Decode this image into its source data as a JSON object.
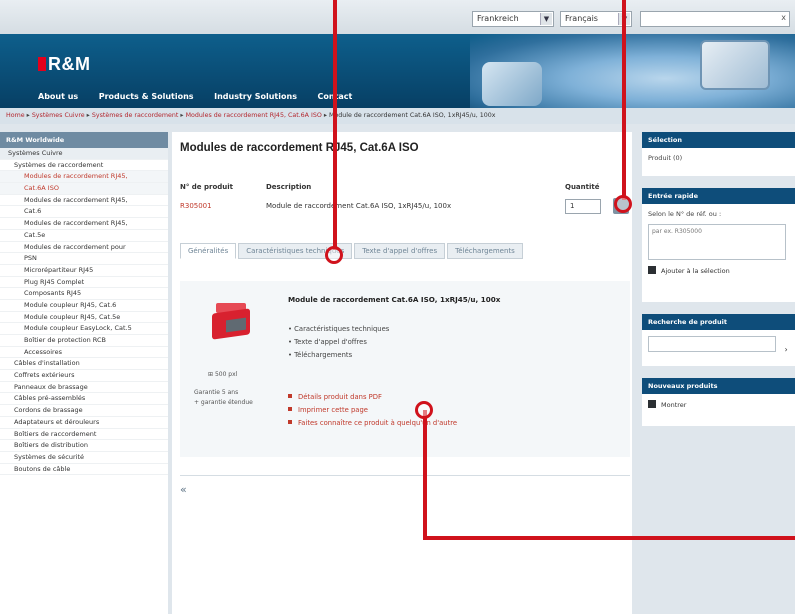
{
  "topbar": {
    "country": "Frankreich",
    "language": "Français",
    "search_close": "x"
  },
  "header": {
    "logo": "R&M",
    "nav": [
      "About us",
      "Products & Solutions",
      "Industry Solutions",
      "Contact"
    ]
  },
  "breadcrumb": {
    "items": [
      "Home",
      "Systèmes Cuivre",
      "Systèmes de raccordement",
      "Modules de raccordement RJ45, Cat.6A ISO"
    ],
    "current": "Module de raccordement Cat.6A ISO, 1xRJ45/u, 100x",
    "separator": "▸"
  },
  "sidebar": {
    "header": "R&M Worldwide",
    "items": [
      {
        "label": "Systèmes Cuivre",
        "level": 0,
        "top": true
      },
      {
        "label": "Systèmes de raccordement",
        "level": 1
      },
      {
        "label": "Modules de raccordement RJ45,",
        "level": 2,
        "active": true
      },
      {
        "label": "Cat.6A ISO",
        "level": 2,
        "active": true
      },
      {
        "label": "Modules de raccordement RJ45,",
        "level": 2
      },
      {
        "label": "Cat.6",
        "level": 2
      },
      {
        "label": "Modules de raccordement RJ45,",
        "level": 2
      },
      {
        "label": "Cat.5e",
        "level": 2
      },
      {
        "label": "Modules de raccordement pour",
        "level": 2
      },
      {
        "label": "PSN",
        "level": 2
      },
      {
        "label": "Microrépartiteur RJ45",
        "level": 2
      },
      {
        "label": "Plug RJ45 Complet",
        "level": 2
      },
      {
        "label": "Composants RJ45",
        "level": 2
      },
      {
        "label": "Module coupleur RJ45, Cat.6",
        "level": 2
      },
      {
        "label": "Module coupleur RJ45, Cat.5e",
        "level": 2
      },
      {
        "label": "Module coupleur EasyLock, Cat.5",
        "level": 2
      },
      {
        "label": "Boîtier de protection RCB",
        "level": 2
      },
      {
        "label": "Accessoires",
        "level": 2
      },
      {
        "label": "Câbles d'installation",
        "level": 1
      },
      {
        "label": "Coffrets extérieurs",
        "level": 1
      },
      {
        "label": "Panneaux de brassage",
        "level": 1
      },
      {
        "label": "Câbles pré-assemblés",
        "level": 1
      },
      {
        "label": "Cordons de brassage",
        "level": 1
      },
      {
        "label": "Adaptateurs et dérouleurs",
        "level": 1
      },
      {
        "label": "Boîtiers de raccordement",
        "level": 1
      },
      {
        "label": "Boîtiers de distribution",
        "level": 1
      },
      {
        "label": "Systèmes de sécurité",
        "level": 1
      },
      {
        "label": "Boutons de câble",
        "level": 1
      }
    ]
  },
  "main": {
    "title": "Modules de raccordement RJ45, Cat.6A ISO",
    "table": {
      "col_number": "N° de produit",
      "col_description": "Description",
      "col_quantity": "Quantité",
      "product_number": "R305001",
      "product_description": "Module de raccordement Cat.6A ISO, 1xRJ45/u, 100x",
      "quantity": "1"
    },
    "tabs": [
      "Généralités",
      "Caractéristiques techniques",
      "Texte d'appel d'offres",
      "Téléchargements"
    ],
    "panel": {
      "title": "Module de raccordement Cat.6A ISO, 1xRJ45/u, 100x",
      "zoom_label": "500 pxl",
      "warranty": [
        "Garantie 5 ans",
        "+ garantie étendue"
      ],
      "bullets": [
        "Caractéristiques techniques",
        "Texte d'appel d'offres",
        "Téléchargements"
      ],
      "links": [
        "Détails produit dans PDF",
        "Imprimer cette page",
        "Faites connaître ce produit à quelqu'un d'autre"
      ]
    },
    "back": "«"
  },
  "right": {
    "selection": {
      "header": "Sélection",
      "text": "Produit (0)"
    },
    "quick_entry": {
      "header": "Entrée rapide",
      "label": "Selon le N° de réf. ou :",
      "placeholder": "par ex. R305000",
      "add": "Ajouter à la sélection"
    },
    "product_search": {
      "header": "Recherche de produit",
      "go": "›"
    },
    "new_products": {
      "header": "Nouveaux produits",
      "item": "Montrer"
    }
  },
  "colors": {
    "brand_blue": "#0e4d7a",
    "brand_red": "#e3001b",
    "callout_red": "#d0121c",
    "link_red": "#c0392b"
  }
}
